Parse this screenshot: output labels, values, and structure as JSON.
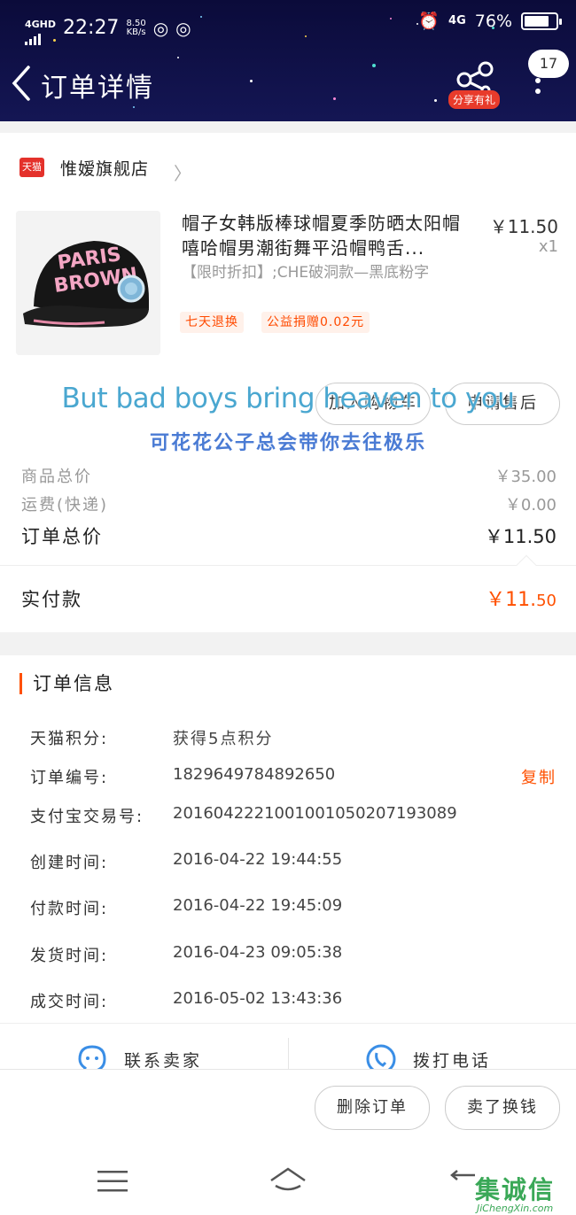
{
  "status_bar": {
    "network": "4GHD",
    "time": "22:27",
    "speed_value": "8.50",
    "speed_unit": "KB/s",
    "network_right": "4G",
    "battery": "76%"
  },
  "header": {
    "title": "订单详情",
    "share_badge": "分享有礼",
    "message_count": "17"
  },
  "shop": {
    "logo_text": "天猫",
    "name": "惟嫒旗舰店"
  },
  "product": {
    "title": "帽子女韩版棒球帽夏季防晒太阳帽嘻哈帽男潮街舞平沿帽鸭舌...",
    "sku": "【限时折扣】;CHE破洞款—黑底粉字",
    "tags": [
      "七天退换",
      "公益捐赠0.02元"
    ],
    "price": "￥11.50",
    "quantity": "x1",
    "cap_text_1": "PARIS",
    "cap_text_2": "BROWN"
  },
  "actions": {
    "add_cart": "加入购物车",
    "after_sale": "申请售后"
  },
  "subtitles": {
    "english": "But bad boys bring heaven to you",
    "chinese": "可花花公子总会带你去往极乐"
  },
  "totals": {
    "goods_label": "商品总价",
    "goods_value": "￥35.00",
    "shipping_label": "运费(快递)",
    "shipping_value": "￥0.00",
    "order_total_label": "订单总价",
    "order_total_value": "￥11.50",
    "paid_label": "实付款",
    "paid_yuan": "￥11.",
    "paid_fen": "50"
  },
  "order_info": {
    "title": "订单信息",
    "rows": [
      {
        "label": "天猫积分:",
        "value": "获得5点积分"
      },
      {
        "label": "订单编号:",
        "value": "1829649784892650"
      },
      {
        "label": "支付宝交易号:",
        "value": "2016042221001001050207193089"
      },
      {
        "label": "创建时间:",
        "value": "2016-04-22 19:44:55"
      },
      {
        "label": "付款时间:",
        "value": "2016-04-22 19:45:09"
      },
      {
        "label": "发货时间:",
        "value": "2016-04-23 09:05:38"
      },
      {
        "label": "成交时间:",
        "value": "2016-05-02 13:43:36"
      }
    ],
    "copy_label": "复制"
  },
  "contact": {
    "seller": "联系卖家",
    "phone": "拨打电话"
  },
  "bottom_actions": {
    "delete": "删除订单",
    "sell": "卖了换钱"
  },
  "watermark": {
    "main": "集诚信",
    "sub": "JiChengXin.com"
  },
  "colors": {
    "accent": "#ff5000",
    "header_bg": "#0b0b3a",
    "subtitle_en": "#4aa7d0",
    "subtitle_cn": "#4a7bd4"
  }
}
